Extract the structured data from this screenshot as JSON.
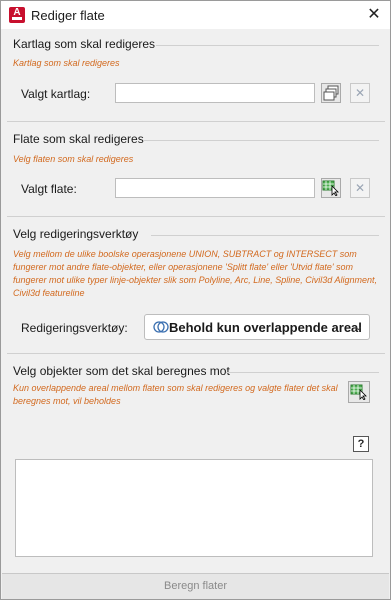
{
  "window": {
    "title": "Rediger flate",
    "close_glyph": "✕"
  },
  "section_layer": {
    "title": "Kartlag som skal redigeres",
    "hint": "Kartlag som skal redigeres",
    "field_label": "Valgt kartlag:",
    "field_value": "",
    "pick_icon": "layers-icon",
    "clear_glyph": "✕"
  },
  "section_surface": {
    "title": "Flate som skal redigeres",
    "hint": "Velg flaten som skal redigeres",
    "field_label": "Valgt flate:",
    "field_value": "",
    "pick_icon": "select-grid-cursor-icon",
    "clear_glyph": "✕"
  },
  "section_tool": {
    "title": "Velg redigeringsverktøy",
    "hint": "Velg mellom de ulike boolske operasjonene UNION, SUBTRACT og INTERSECT som fungerer mot andre flate-objekter, eller operasjonene 'Splitt flate' eller 'Utvid flate' som fungerer mot ulike typer linje-objekter slik som Polyline, Arc, Line, Spline, Civil3d Alignment, Civil3d featureline",
    "field_label": "Redigeringsverktøy:",
    "selected_tool": "Behold kun overlappende areal",
    "tool_icon": "intersect-icon",
    "chevron_glyph": "⌄"
  },
  "section_objects": {
    "title": "Velg objekter som det skal beregnes mot",
    "hint": "Kun overlappende areal mellom flaten som skal redigeres og valgte flater det skal beregnes mot, vil beholdes",
    "pick_icon": "select-grid-cursor-icon",
    "help_glyph": "?",
    "items": []
  },
  "footer": {
    "calculate_label": "Beregn flater"
  },
  "colors": {
    "hint": "#d2691e",
    "app_icon": "#c8102e",
    "pick_grid": "#4caf50"
  }
}
